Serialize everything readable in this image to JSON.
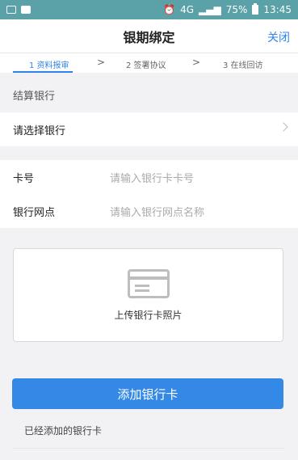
{
  "statusbar": {
    "signal_text": "4G",
    "battery": "75%",
    "time": "13:45"
  },
  "navbar": {
    "title": "银期绑定",
    "close_label": "关闭"
  },
  "steps": {
    "step1": "1 资料报审",
    "step2": "2 签署协议",
    "step3": "3 在线回访",
    "arrow": ">"
  },
  "form": {
    "section_title": "结算银行",
    "bank_select_label": "请选择银行",
    "card_label": "卡号",
    "card_placeholder": "请输入银行卡卡号",
    "branch_label": "银行网点",
    "branch_placeholder": "请输入银行网点名称"
  },
  "upload": {
    "label": "上传银行卡照片",
    "icon": "bank-card-icon"
  },
  "actions": {
    "add_button": "添加银行卡",
    "added_label": "已经添加的银行卡"
  },
  "colors": {
    "accent": "#3489e6",
    "statusbar": "#5aa1a8"
  }
}
